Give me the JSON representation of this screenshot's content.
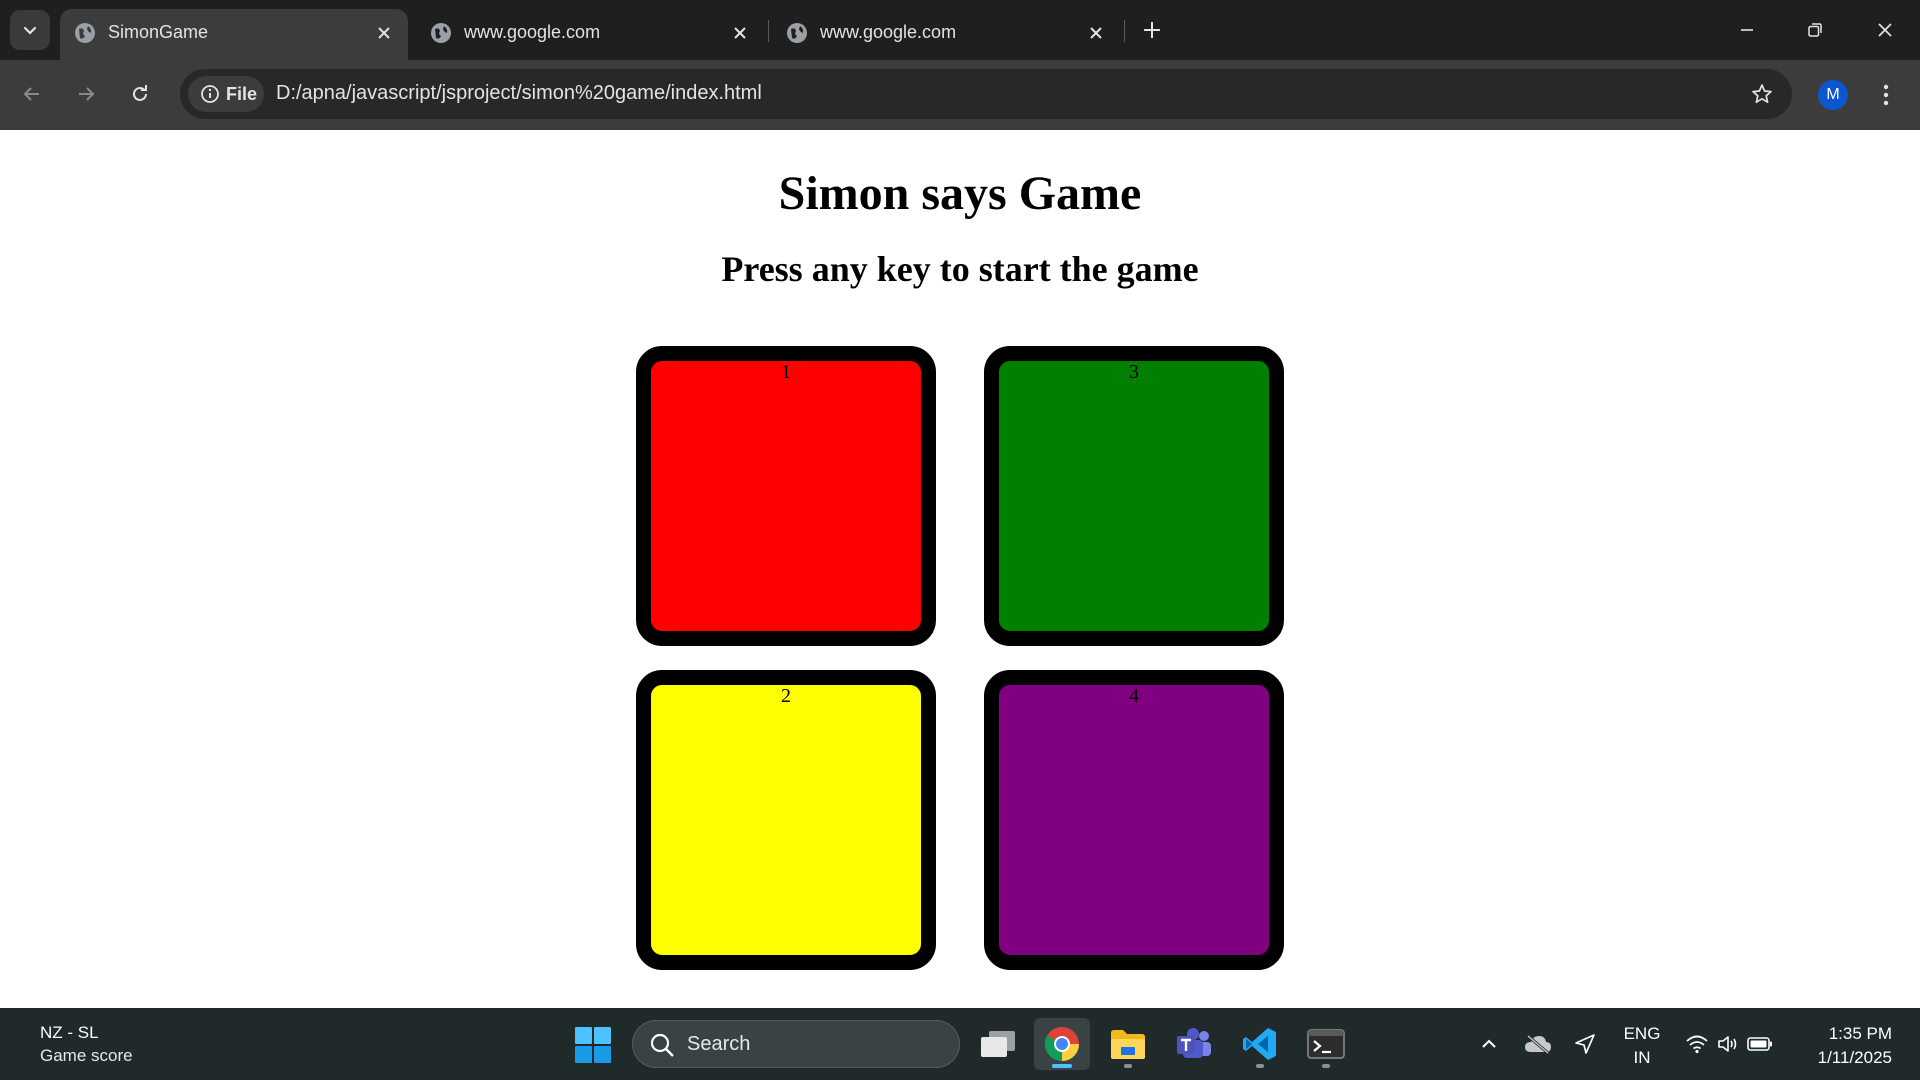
{
  "browser": {
    "tabs": [
      {
        "title": "SimonGame",
        "active": true
      },
      {
        "title": "www.google.com",
        "active": false
      },
      {
        "title": "www.google.com",
        "active": false
      }
    ],
    "site_chip_label": "File",
    "url": "D:/apna/javascript/jsproject/simon%20game/index.html",
    "profile_initial": "M"
  },
  "page": {
    "title": "Simon says Game",
    "subtitle": "Press any key to start the game",
    "buttons": [
      {
        "label": "1",
        "color": "#ff0000"
      },
      {
        "label": "2",
        "color": "#ffff00"
      },
      {
        "label": "3",
        "color": "#008000"
      },
      {
        "label": "4",
        "color": "#800080"
      }
    ]
  },
  "taskbar": {
    "weather_line1": "NZ - SL",
    "weather_line2": "Game score",
    "search_label": "Search",
    "lang_line1": "ENG",
    "lang_line2": "IN",
    "time": "1:35 PM",
    "date": "1/11/2025"
  }
}
